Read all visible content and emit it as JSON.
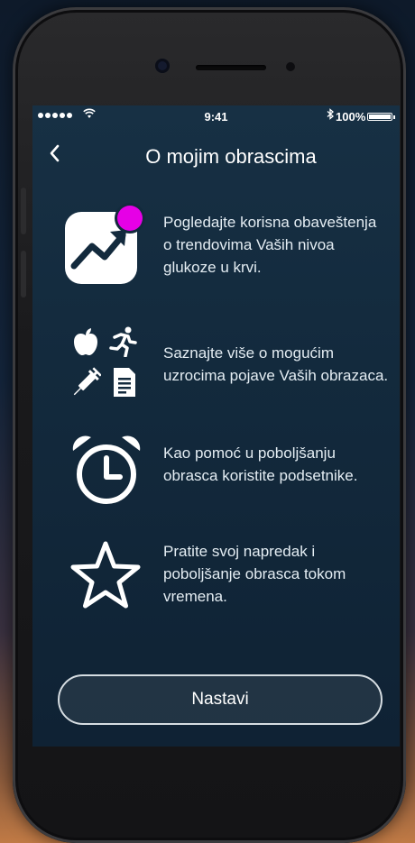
{
  "status_bar": {
    "time": "9:41",
    "battery_percent": "100%",
    "signal_bars": 5,
    "icons": [
      "wifi-icon",
      "bluetooth-icon",
      "battery-icon"
    ]
  },
  "header": {
    "back_icon": "chevron-left-icon",
    "title": "O mojim obrascima"
  },
  "features": [
    {
      "icon": "trend-notification-icon",
      "text": "Pogledajte korisna obaveštenja o trendovima Vaših nivoa glukoze u krvi."
    },
    {
      "icon": "causes-icons-apple-runner-syringe-document",
      "text": "Saznajte više o mogućim uzrocima pojave Vaših obrazaca."
    },
    {
      "icon": "alarm-clock-icon",
      "text": "Kao pomoć u poboljšanju obrasca koristite podsetnike."
    },
    {
      "icon": "star-icon",
      "text": "Pratite svoj napredak i poboljšanje obrasca tokom vremena."
    }
  ],
  "primary_button": {
    "label": "Nastavi"
  },
  "colors": {
    "screen_background": "#132a3d",
    "notification_badge": "#e600e6",
    "text": "#ffffff"
  }
}
